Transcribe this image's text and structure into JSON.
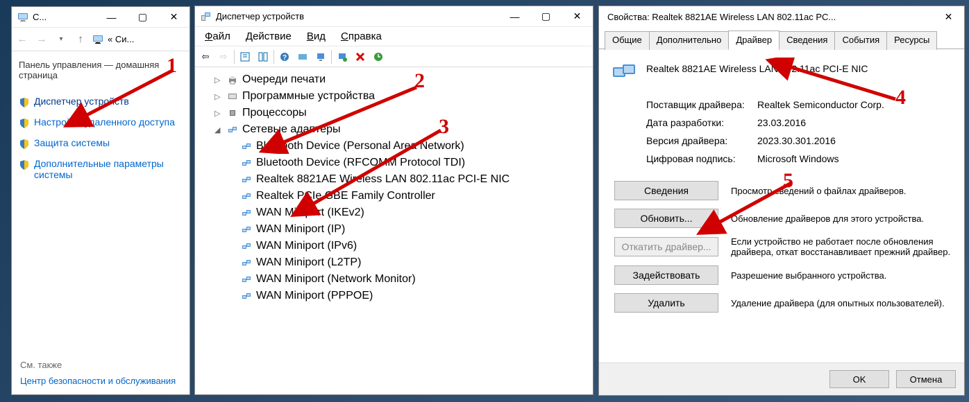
{
  "annotations": [
    "1",
    "2",
    "3",
    "4",
    "5"
  ],
  "w1": {
    "title": "С...",
    "addr": "« Си...",
    "home_label": "Панель управления — домашняя страница",
    "links": [
      "Диспетчер устройств",
      "Настройка удаленного доступа",
      "Защита системы",
      "Дополнительные параметры системы"
    ],
    "see_also": "См. также",
    "footer_link": "Центр безопасности и обслуживания"
  },
  "w2": {
    "title": "Диспетчер устройств",
    "menu": [
      "Файл",
      "Действие",
      "Вид",
      "Справка"
    ],
    "nodes": [
      {
        "label": "Очереди печати",
        "icon": "printer",
        "level": 1,
        "arrow": ">"
      },
      {
        "label": "Программные устройства",
        "icon": "device",
        "level": 1,
        "arrow": ">"
      },
      {
        "label": "Процессоры",
        "icon": "cpu",
        "level": 1,
        "arrow": ">"
      },
      {
        "label": "Сетевые адаптеры",
        "icon": "net",
        "level": 1,
        "arrow": "v"
      },
      {
        "label": "Bluetooth Device (Personal Area Network)",
        "icon": "net",
        "level": 2
      },
      {
        "label": "Bluetooth Device (RFCOMM Protocol TDI)",
        "icon": "net",
        "level": 2
      },
      {
        "label": "Realtek 8821AE Wireless LAN 802.11ac PCI-E NIC",
        "icon": "net",
        "level": 2
      },
      {
        "label": "Realtek PCIe GBE Family Controller",
        "icon": "net",
        "level": 2
      },
      {
        "label": "WAN Miniport (IKEv2)",
        "icon": "net",
        "level": 2
      },
      {
        "label": "WAN Miniport (IP)",
        "icon": "net",
        "level": 2
      },
      {
        "label": "WAN Miniport (IPv6)",
        "icon": "net",
        "level": 2
      },
      {
        "label": "WAN Miniport (L2TP)",
        "icon": "net",
        "level": 2
      },
      {
        "label": "WAN Miniport (Network Monitor)",
        "icon": "net",
        "level": 2
      },
      {
        "label": "WAN Miniport (PPPOE)",
        "icon": "net",
        "level": 2
      }
    ]
  },
  "w3": {
    "title": "Свойства: Realtek 8821AE Wireless LAN 802.11ac PC...",
    "tabs": [
      "Общие",
      "Дополнительно",
      "Драйвер",
      "Сведения",
      "События",
      "Ресурсы"
    ],
    "active_tab": 2,
    "device_name": "Realtek 8821AE Wireless LAN 802.11ac PCI-E NIC",
    "props": [
      {
        "label": "Поставщик драйвера:",
        "value": "Realtek Semiconductor Corp."
      },
      {
        "label": "Дата разработки:",
        "value": "23.03.2016"
      },
      {
        "label": "Версия драйвера:",
        "value": "2023.30.301.2016"
      },
      {
        "label": "Цифровая подпись:",
        "value": "Microsoft Windows"
      }
    ],
    "actions": [
      {
        "btn": "Сведения",
        "desc": "Просмотр сведений о файлах драйверов.",
        "disabled": false
      },
      {
        "btn": "Обновить...",
        "desc": "Обновление драйверов для этого устройства.",
        "disabled": false
      },
      {
        "btn": "Откатить драйвер...",
        "desc": "Если устройство не работает после обновления драйвера, откат восстанавливает прежний драйвер.",
        "disabled": true
      },
      {
        "btn": "Задействовать",
        "desc": "Разрешение выбранного устройства.",
        "disabled": false
      },
      {
        "btn": "Удалить",
        "desc": "Удаление драйвера (для опытных пользователей).",
        "disabled": false
      }
    ],
    "ok": "OK",
    "cancel": "Отмена"
  }
}
